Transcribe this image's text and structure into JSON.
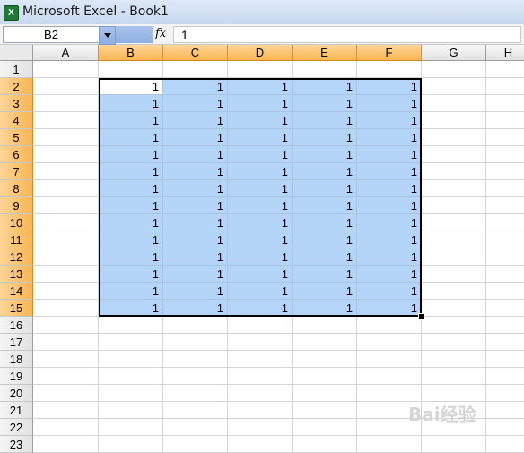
{
  "window": {
    "title": "Microsoft Excel - Book1"
  },
  "formula_bar": {
    "name_box": "B2",
    "fx": "fx",
    "formula": "1"
  },
  "columns": [
    "A",
    "B",
    "C",
    "D",
    "E",
    "F",
    "G",
    "H"
  ],
  "rows": [
    "1",
    "2",
    "3",
    "4",
    "5",
    "6",
    "7",
    "8",
    "9",
    "10",
    "11",
    "12",
    "13",
    "14",
    "15",
    "16",
    "17",
    "18",
    "19",
    "20",
    "21",
    "22",
    "23"
  ],
  "cell_value": "1",
  "selection": {
    "range": "B2:F15",
    "active_cell": "B2"
  },
  "watermark": "Bai经验"
}
